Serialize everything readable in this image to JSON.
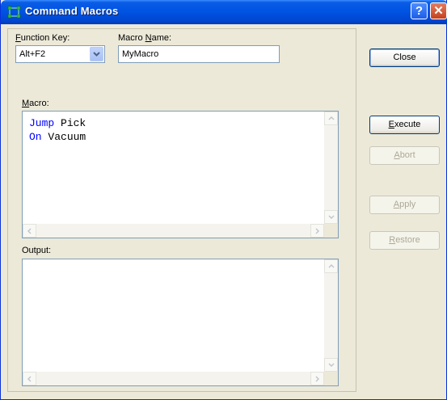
{
  "window": {
    "title": "Command Macros",
    "help_glyph": "?",
    "close_glyph": "✕"
  },
  "function_key": {
    "label_prefix": "F",
    "label_rest": "unction Key:",
    "value": "Alt+F2"
  },
  "macro_name": {
    "label_prefix": "Macro ",
    "label_access": "N",
    "label_rest": "ame:",
    "value": "MyMacro"
  },
  "macro": {
    "label_access": "M",
    "label_rest": "acro:",
    "lines": [
      {
        "keyword": "Jump",
        "arg": " Pick"
      },
      {
        "keyword": "On",
        "arg": " Vacuum"
      }
    ]
  },
  "output": {
    "label": "Output:"
  },
  "buttons": {
    "close": "Close",
    "execute_access": "E",
    "execute_rest": "xecute",
    "abort_access": "A",
    "abort_rest": "bort",
    "apply_access": "A",
    "apply_rest": "pply",
    "restore_access": "R",
    "restore_rest": "estore"
  },
  "colors": {
    "keyword": "#0000ff",
    "titlebar": "#0054e3",
    "face": "#ece9d8"
  }
}
